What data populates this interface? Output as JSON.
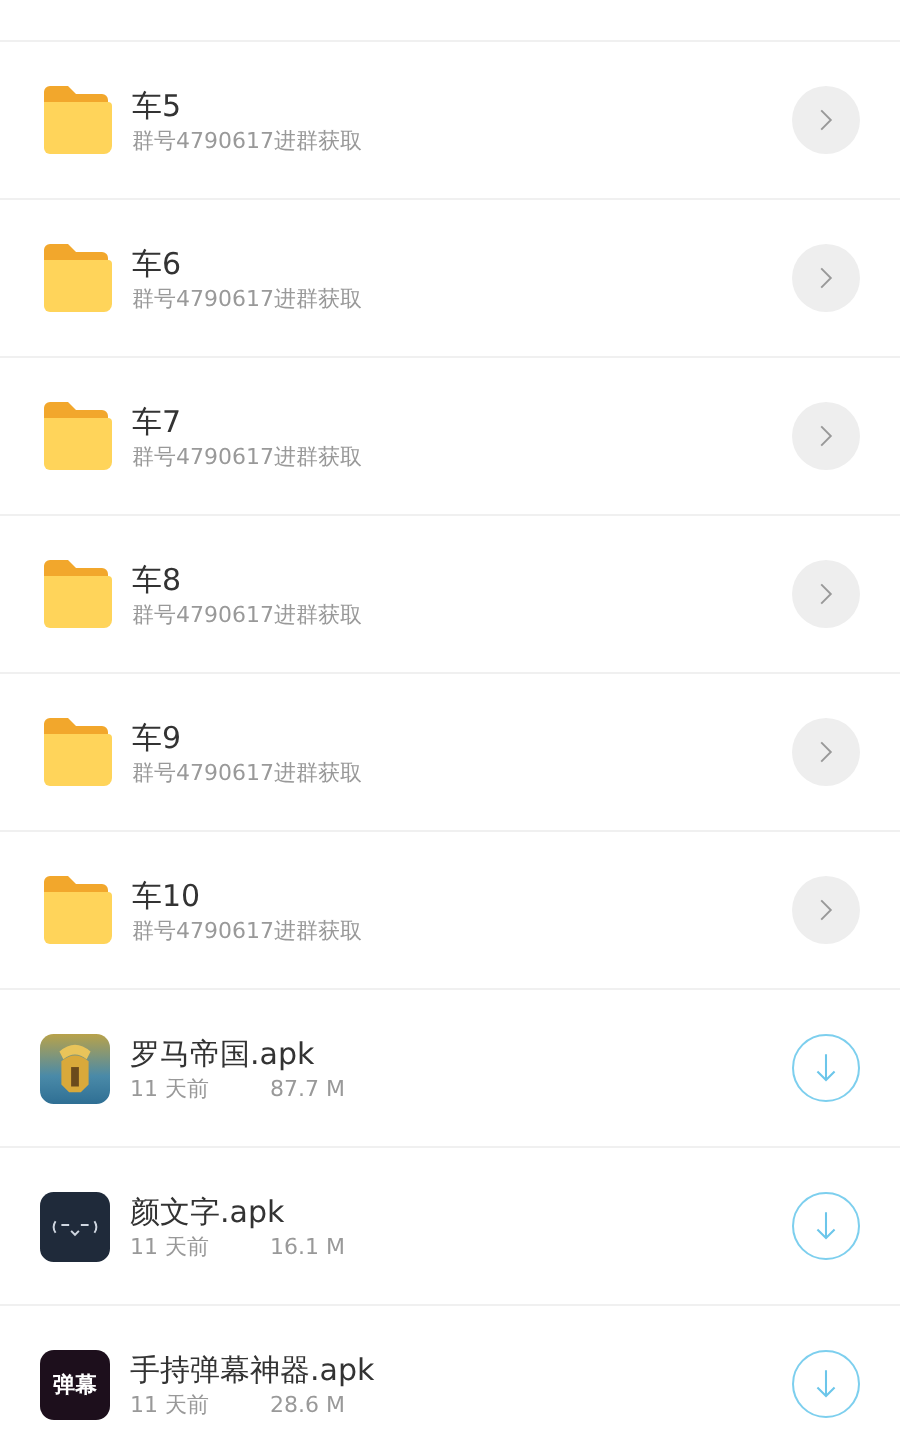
{
  "items": [
    {
      "kind": "folder",
      "title": "车5",
      "subtitle": "群号4790617进群获取"
    },
    {
      "kind": "folder",
      "title": "车6",
      "subtitle": "群号4790617进群获取"
    },
    {
      "kind": "folder",
      "title": "车7",
      "subtitle": "群号4790617进群获取"
    },
    {
      "kind": "folder",
      "title": "车8",
      "subtitle": "群号4790617进群获取"
    },
    {
      "kind": "folder",
      "title": "车9",
      "subtitle": "群号4790617进群获取"
    },
    {
      "kind": "folder",
      "title": "车10",
      "subtitle": "群号4790617进群获取"
    },
    {
      "kind": "apk",
      "title": "罗马帝国.apk",
      "date": "11 天前",
      "size": "87.7 M"
    },
    {
      "kind": "apk",
      "title": "颜文字.apk",
      "date": "11 天前",
      "size": "16.1 M"
    },
    {
      "kind": "apk",
      "title": "手持弹幕神器.apk",
      "date": "11 天前",
      "size": "28.6 M",
      "icon_text": "弹幕"
    }
  ]
}
